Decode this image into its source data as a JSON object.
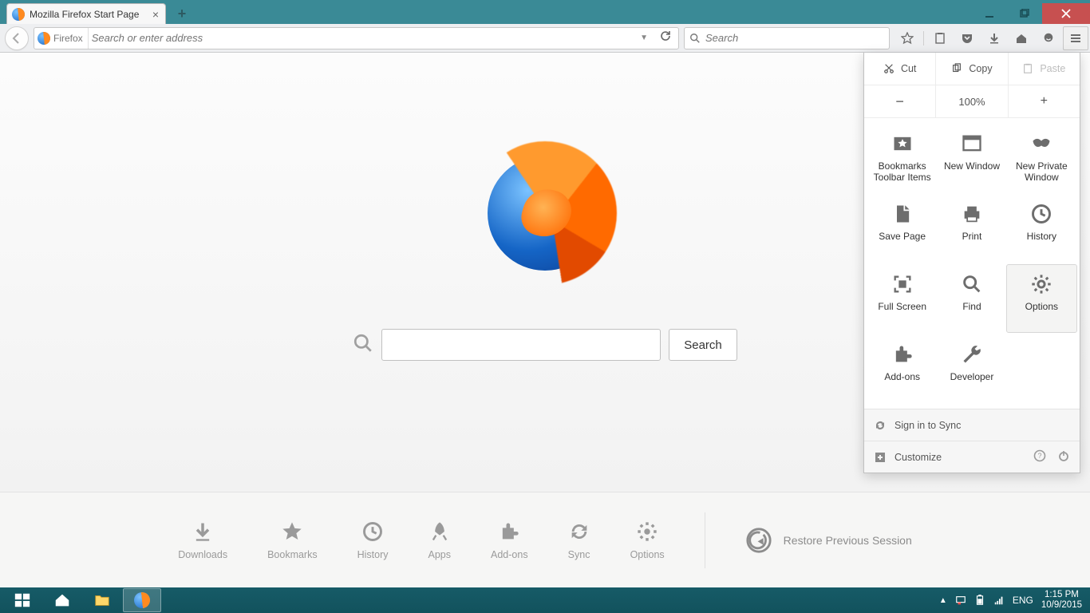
{
  "tab": {
    "title": "Mozilla Firefox Start Page"
  },
  "toolbar": {
    "identity_label": "Firefox",
    "url_placeholder": "Search or enter address",
    "search_placeholder": "Search"
  },
  "startpage": {
    "search_button": "Search",
    "launchers": [
      "Downloads",
      "Bookmarks",
      "History",
      "Apps",
      "Add-ons",
      "Sync",
      "Options"
    ],
    "restore_label": "Restore Previous Session"
  },
  "menu": {
    "cut": "Cut",
    "copy": "Copy",
    "paste": "Paste",
    "zoom": "100%",
    "items": [
      "Bookmarks Toolbar Items",
      "New Window",
      "New Private Window",
      "Save Page",
      "Print",
      "History",
      "Full Screen",
      "Find",
      "Options",
      "Add-ons",
      "Developer"
    ],
    "sign_in": "Sign in to Sync",
    "customize": "Customize"
  },
  "tray": {
    "lang": "ENG",
    "time": "1:15 PM",
    "date": "10/9/2015"
  }
}
